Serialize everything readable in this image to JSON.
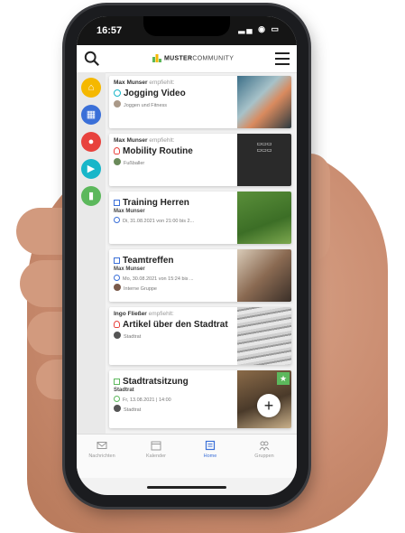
{
  "status": {
    "time": "16:57",
    "icons": "▂▄ ◉ ▭"
  },
  "header": {
    "logo_bold": "MUSTER",
    "logo_light": "COMMUNITY"
  },
  "side_circles": [
    {
      "color": "#f5b800"
    },
    {
      "color": "#3a6fd8"
    },
    {
      "color": "#e8423d"
    },
    {
      "color": "#18b6c9"
    },
    {
      "color": "#5cb85c"
    }
  ],
  "feed": [
    {
      "who": "Max Munser",
      "action": "empfiehlt:",
      "title": "Jogging Video",
      "tag": "Joggen und Fitness",
      "icon_color": "#18b6c9"
    },
    {
      "who": "Max Munser",
      "action": "empfiehlt:",
      "title": "Mobility Routine",
      "tag": "Fußballer",
      "icon_color": "#e8423d"
    },
    {
      "title": "Training Herren",
      "sub": "Max Munser",
      "meta": "Di, 31.08.2021 von 21:00 bis 2...",
      "icon_color": "#3a6fd8"
    },
    {
      "title": "Teamtreffen",
      "sub": "Max Munser",
      "meta": "Mo, 30.08.2021 von 15:24 bis ...",
      "tag": "Interne Gruppe",
      "icon_color": "#3a6fd8"
    },
    {
      "who": "Ingo Fließer",
      "action": "empfiehlt:",
      "title": "Artikel über den Stadtrat",
      "tag": "Stadtrat",
      "icon_color": "#e8423d"
    },
    {
      "title": "Stadtratsitzung",
      "sub": "Stadtrat",
      "meta": "Fr, 13.08.2021 | 14:00",
      "tag": "Stadtrat",
      "icon_color": "#5cb85c"
    }
  ],
  "tabs": [
    {
      "label": "Nachrichten"
    },
    {
      "label": "Kalender"
    },
    {
      "label": "Home"
    },
    {
      "label": "Gruppen"
    }
  ],
  "colors": {
    "accent": "#3a6fd8",
    "green": "#5cb85c"
  }
}
